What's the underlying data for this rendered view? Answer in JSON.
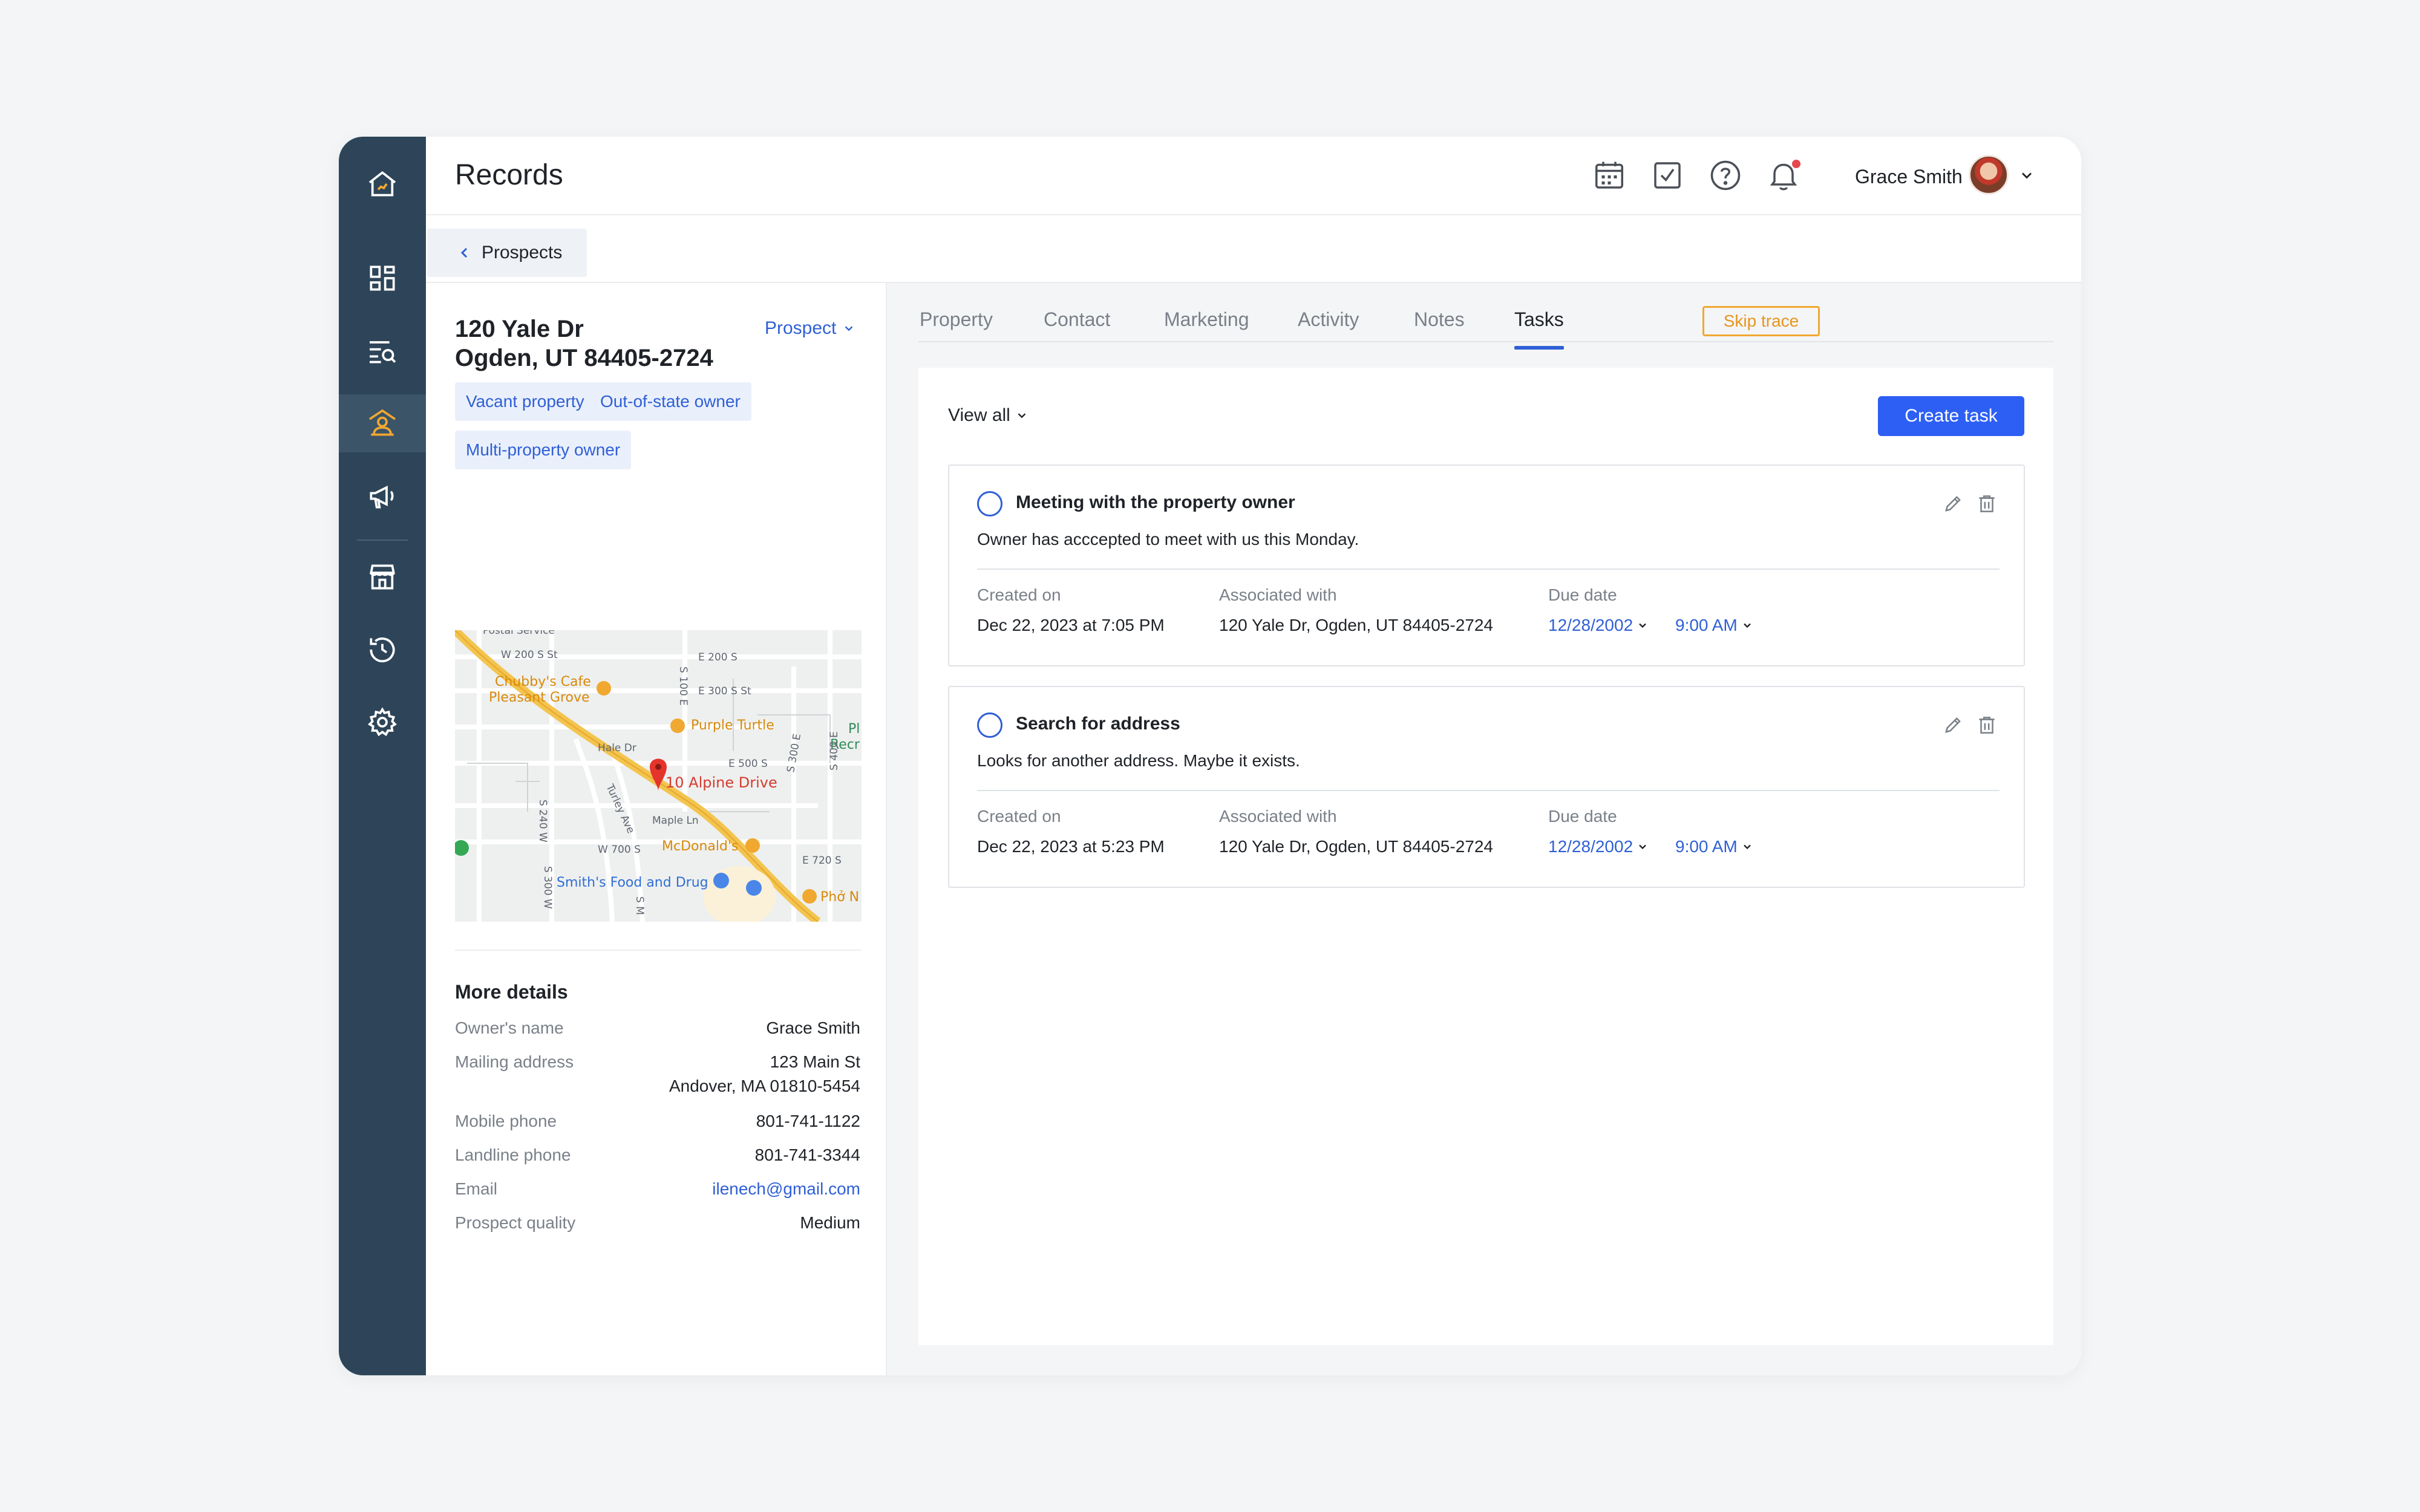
{
  "header": {
    "title": "Records",
    "user_name": "Grace Smith",
    "icons": [
      "calendar-icon",
      "task-check-icon",
      "help-icon",
      "bell-icon"
    ]
  },
  "sidebar": {
    "items": [
      {
        "name": "home-icon"
      },
      {
        "name": "dashboard-icon"
      },
      {
        "name": "search-list-icon"
      },
      {
        "name": "prospects-icon",
        "active": true
      },
      {
        "name": "marketing-icon"
      },
      {
        "name": "store-icon"
      },
      {
        "name": "history-icon"
      },
      {
        "name": "settings-icon"
      }
    ]
  },
  "breadcrumb": {
    "label": "Prospects"
  },
  "property": {
    "address_line1": "120 Yale Dr",
    "address_line2": "Ogden, UT 84405-2724",
    "status": "Prospect",
    "tags": [
      "Vacant property",
      "Out-of-state owner",
      "Multi-property owner"
    ]
  },
  "map": {
    "labels": {
      "postal": "Postal Service",
      "w200": "W 200 S St",
      "e200": "E 200 S",
      "e300": "E 300 S St",
      "chubby1": "Chubby's Cafe",
      "chubby2": "Pleasant Grove",
      "purple": "Purple Turtle",
      "pl": "Pl",
      "recr": "Recr",
      "haledr": "Hale Dr",
      "e500": "E 500 S",
      "alpine": "10 Alpine Drive",
      "maple": "Maple Ln",
      "w700": "W 700 S",
      "mcd": "McDonald's",
      "e720": "E 720 S",
      "smiths": "Smith's Food and Drug",
      "pho": "Phở N",
      "s100e": "S 100 E",
      "s300e": "S 300 E",
      "s400e": "S 400 E",
      "s240w": "S 240 W",
      "s300w": "S 300 W",
      "turley": "Turley Ave",
      "sm": "S M"
    }
  },
  "details": {
    "title": "More details",
    "rows": [
      {
        "label": "Owner's name",
        "value": "Grace Smith"
      },
      {
        "label": "Mailing address",
        "value": "123 Main St",
        "value2": "Andover, MA 01810-5454"
      },
      {
        "label": "Mobile phone",
        "value": "801-741-1122"
      },
      {
        "label": "Landline phone",
        "value": "801-741-3344"
      },
      {
        "label": "Email",
        "value": "ilenech@gmail.com"
      },
      {
        "label": "Prospect quality",
        "value": "Medium"
      }
    ]
  },
  "tabs": [
    "Property",
    "Contact",
    "Marketing",
    "Activity",
    "Notes",
    "Tasks"
  ],
  "active_tab": "Tasks",
  "skip_trace_label": "Skip trace",
  "tasks_toolbar": {
    "filter": "View all",
    "create_label": "Create task"
  },
  "tasks": [
    {
      "title": "Meeting with the property owner",
      "description": "Owner has acccepted to meet with us this Monday.",
      "created_label": "Created on",
      "created_on": "Dec 22, 2023 at 7:05 PM",
      "assoc_label": "Associated with",
      "associated_with": "120 Yale Dr, Ogden, UT 84405-2724",
      "due_label": "Due date",
      "due_date": "12/28/2002",
      "due_time": "9:00 AM"
    },
    {
      "title": "Search for address",
      "description": "Looks for another address. Maybe it exists.",
      "created_label": "Created on",
      "created_on": "Dec 22, 2023 at 5:23 PM",
      "assoc_label": "Associated with",
      "associated_with": "120 Yale Dr, Ogden, UT 84405-2724",
      "due_label": "Due date",
      "due_date": "12/28/2002",
      "due_time": "9:00 AM"
    }
  ],
  "colors": {
    "sidebar": "#2e4559",
    "accent": "#2f5fd6",
    "primary_button": "#2d5ff5",
    "skip_trace": "#f0a830",
    "active_nav_icon": "#f0a830"
  }
}
